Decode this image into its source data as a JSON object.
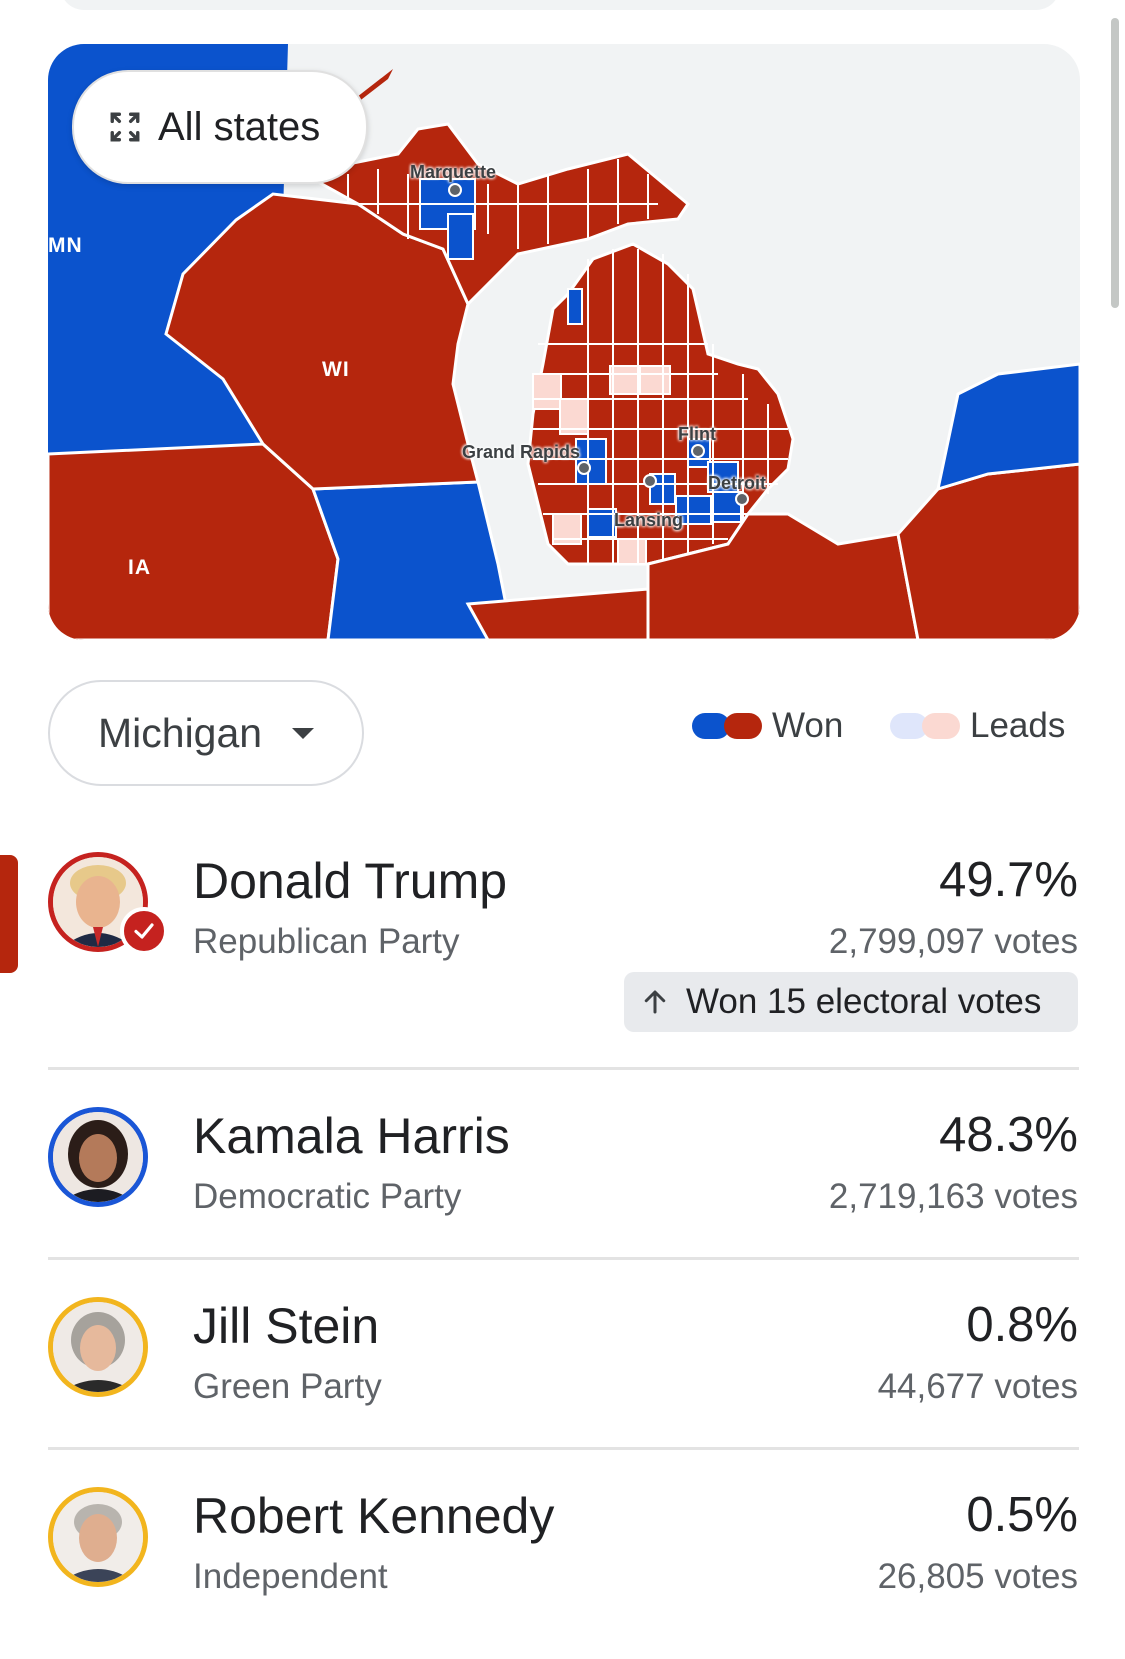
{
  "colors": {
    "rep_won": "#b5260d",
    "dem_won": "#0b53cd",
    "rep_leads": "#fbd9d2",
    "dem_leads": "#dfe6fb",
    "water": "#eceef1"
  },
  "map": {
    "button_label": "All states",
    "button_icon": "expand-icon",
    "state_labels": [
      "MN",
      "WI",
      "IA"
    ],
    "cities": [
      "Marquette",
      "Grand Rapids",
      "Flint",
      "Detroit",
      "Lansing"
    ]
  },
  "selector": {
    "state": "Michigan",
    "icon": "chevron-down-icon"
  },
  "legend": {
    "won": "Won",
    "leads": "Leads"
  },
  "candidates": [
    {
      "name": "Donald Trump",
      "party": "Republican Party",
      "percent": "49.7%",
      "votes": "2,799,097 votes",
      "electoral": "Won 15 electoral votes",
      "ring_color": "#c5221f"
    },
    {
      "name": "Kamala Harris",
      "party": "Democratic Party",
      "percent": "48.3%",
      "votes": "2,719,163 votes",
      "ring_color": "#1a56d6"
    },
    {
      "name": "Jill Stein",
      "party": "Green Party",
      "percent": "0.8%",
      "votes": "44,677 votes",
      "ring_color": "#f2b51e"
    },
    {
      "name": "Robert Kennedy",
      "party": "Independent",
      "percent": "0.5%",
      "votes": "26,805 votes",
      "ring_color": "#f2b51e"
    }
  ]
}
